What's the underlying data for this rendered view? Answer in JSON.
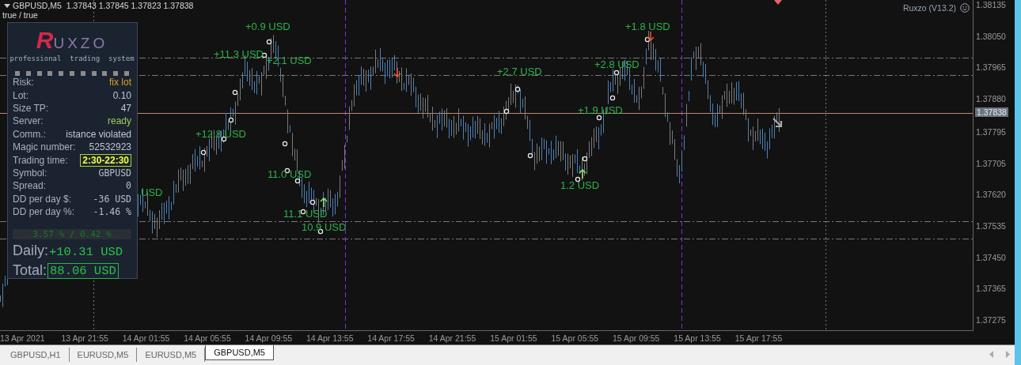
{
  "header": {
    "symbol": "GBPUSD,M5",
    "quotes": "1.37843 1.37845 1.37823 1.37838",
    "flags": "true / true",
    "expert": "Ruxzo (V13.2)"
  },
  "panel": {
    "logo": {
      "initial": "R",
      "rest": "UXZO"
    },
    "tagline": "professional  trading  system",
    "rows": [
      {
        "label": "Risk:",
        "value": "fix lot",
        "kind": "warn"
      },
      {
        "label": "Lot:",
        "value": "0.10",
        "kind": "plain"
      },
      {
        "label": "Size TP:",
        "value": "47",
        "kind": "plain"
      },
      {
        "label": "Server:",
        "value": "ready",
        "kind": "ok"
      },
      {
        "label": "Comm.:",
        "value": "istance violated",
        "kind": "plain"
      },
      {
        "label": "Magic number:",
        "value": "52532923",
        "kind": "plain"
      },
      {
        "label": "Trading time:",
        "value": "2:30-22:30",
        "kind": "boxed"
      },
      {
        "label": "Symbol:",
        "value": "GBPUSD",
        "kind": "mono"
      },
      {
        "label": "Spread:",
        "value": "0",
        "kind": "mono"
      },
      {
        "label": "DD per day $:",
        "value": "-36 USD",
        "kind": "mono"
      },
      {
        "label": "DD per day %:",
        "value": "-1.46 %",
        "kind": "mono"
      }
    ],
    "ratio": "3.57 % / 0.42 %",
    "daily": {
      "label": "Daily:",
      "value": "+10.31 USD"
    },
    "total": {
      "label": "Total:",
      "value": "88.06 USD"
    }
  },
  "trade_labels": [
    "+0.9 USD",
    "+11.3 USD",
    "+2.1 USD",
    "+12.8 USD",
    "USD",
    "11.0 USD",
    "11.1 USD",
    "10.9 USD",
    "+2.7 USD",
    "+2.8 USD",
    "+1.9 USD",
    "+1.8 USD",
    "1.2 USD"
  ],
  "price_axis": {
    "labels": [
      "1.38135",
      "1.38050",
      "1.37965",
      "1.37880",
      "1.37795",
      "1.37705",
      "1.37620",
      "1.37535",
      "1.37450",
      "1.37365",
      "1.37275"
    ],
    "current": "1.37838"
  },
  "time_axis": {
    "labels": [
      "13 Apr 2021",
      "13 Apr 21:55",
      "14 Apr 01:55",
      "14 Apr 05:55",
      "14 Apr 09:55",
      "14 Apr 13:55",
      "14 Apr 17:55",
      "14 Apr 21:55",
      "15 Apr 01:55",
      "15 Apr 05:55",
      "15 Apr 09:55",
      "15 Apr 13:55",
      "15 Apr 17:55"
    ]
  },
  "tabs": [
    {
      "label": "GBPUSD,H1",
      "selected": false
    },
    {
      "label": "EURUSD,M5",
      "selected": false
    },
    {
      "label": "EURUSD,M5",
      "selected": false
    },
    {
      "label": "GBPUSD,M5",
      "selected": true
    }
  ]
}
